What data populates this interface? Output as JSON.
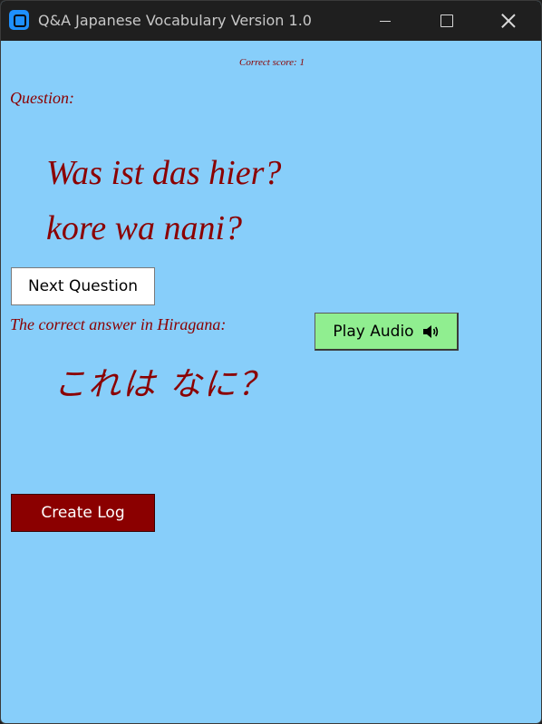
{
  "window": {
    "title": "Q&A Japanese Vocabulary Version 1.0"
  },
  "score": {
    "text": "Correct score: 1"
  },
  "question": {
    "label": "Question:",
    "german": "Was ist das hier?",
    "romaji": "kore wa nani?"
  },
  "buttons": {
    "next": "Next Question",
    "play_audio": "Play Audio",
    "create_log": "Create Log"
  },
  "answer": {
    "label": "The correct answer in Hiragana:",
    "hiragana": "これは なに？"
  },
  "colors": {
    "background": "#87cefa",
    "text": "#8b0000",
    "audio_button": "#90ee90",
    "log_button": "#8b0000"
  },
  "icons": {
    "app": "app-icon",
    "speaker": "speaker-icon"
  }
}
